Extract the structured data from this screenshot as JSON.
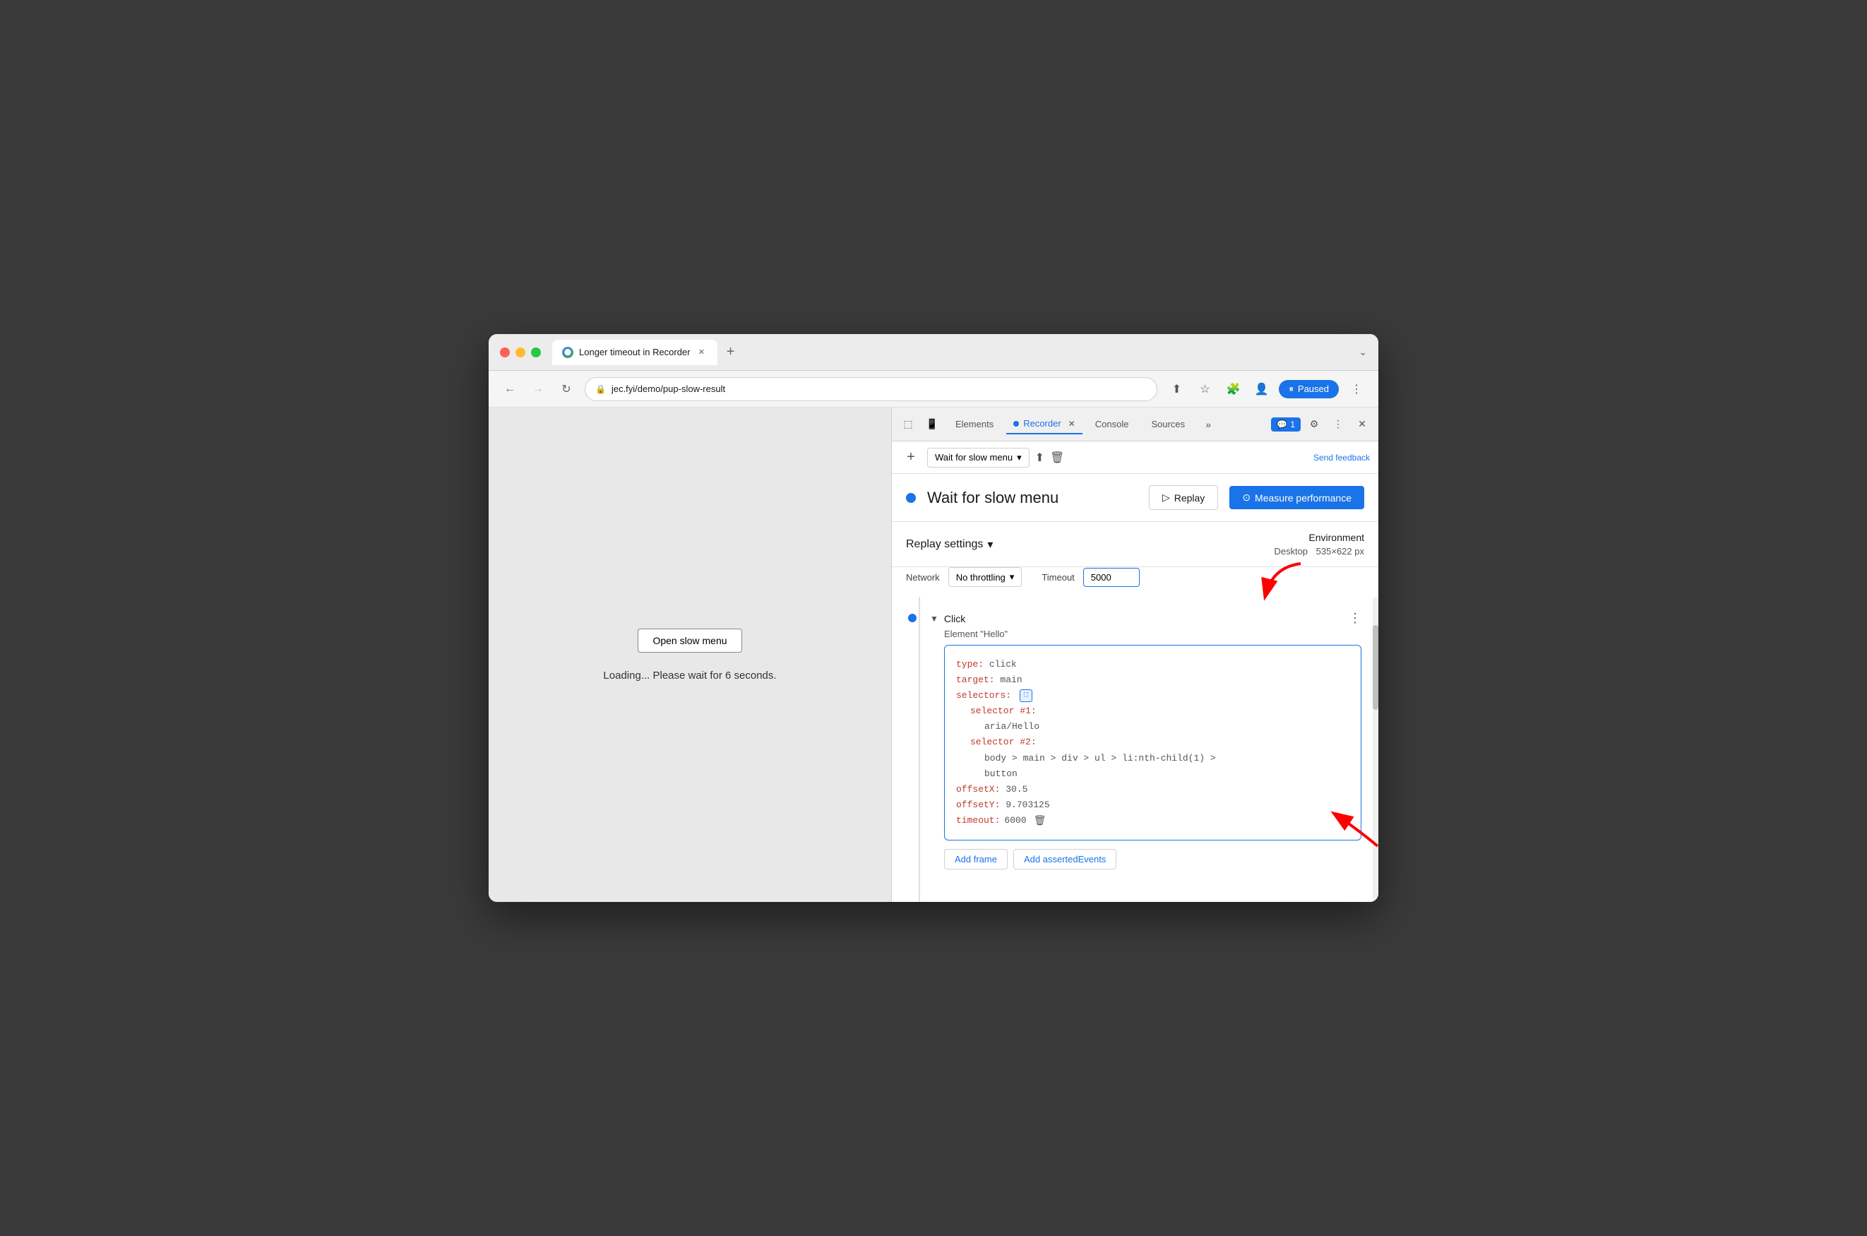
{
  "window": {
    "title": "Longer timeout in Recorder",
    "tab_label": "Longer timeout in Recorder"
  },
  "browser": {
    "url": "jec.fyi/demo/pup-slow-result",
    "back_disabled": false,
    "forward_disabled": true,
    "paused_label": "Paused",
    "open_menu_btn": "Open slow menu",
    "loading_text": "Loading... Please wait for 6 seconds."
  },
  "devtools": {
    "tabs": [
      "Elements",
      "Recorder",
      "Console",
      "Sources"
    ],
    "active_tab": "Recorder",
    "chat_badge": "1",
    "send_feedback": "Send feedback"
  },
  "recorder": {
    "add_icon": "+",
    "recording_name": "Wait for slow menu",
    "title": "Wait for slow menu",
    "replay_label": "Replay",
    "measure_label": "Measure performance",
    "replay_settings_label": "Replay settings",
    "network_label": "Network",
    "network_value": "No throttling",
    "timeout_label": "Timeout",
    "timeout_value": "5000",
    "environment_label": "Environment",
    "environment_type": "Desktop",
    "environment_size": "535×622 px"
  },
  "step": {
    "type_label": "Click",
    "element_label": "Element \"Hello\"",
    "code": {
      "type_key": "type:",
      "type_val": " click",
      "target_key": "target:",
      "target_val": " main",
      "selectors_key": "selectors:",
      "selector1_key": "selector #1:",
      "selector1_val": "aria/Hello",
      "selector2_key": "selector #2:",
      "selector2_val": "body > main > div > ul > li:nth-child(1) >",
      "selector2_val2": "button",
      "offsetX_key": "offsetX:",
      "offsetX_val": " 30.5",
      "offsetY_key": "offsetY:",
      "offsetY_val": " 9.703125",
      "timeout_key": "timeout:",
      "timeout_val": " 6000",
      "add_frame_btn": "Add frame",
      "add_asserted_btn": "Add assertedEvents"
    }
  }
}
